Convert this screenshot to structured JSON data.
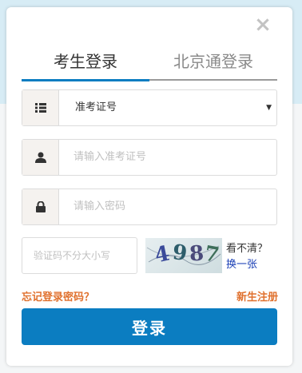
{
  "dialog": {
    "close_glyph": "×",
    "tabs": [
      {
        "label": "考生登录"
      },
      {
        "label": "北京通登录"
      }
    ],
    "id_type": {
      "selected": "准考证号",
      "caret": "▼"
    },
    "id_input": {
      "placeholder": "请输入准考证号"
    },
    "password_input": {
      "placeholder": "请输入密码"
    },
    "captcha": {
      "placeholder": "验证码不分大小写",
      "code": [
        "4",
        "9",
        "8",
        "7"
      ],
      "unclear_label": "看不清？",
      "refresh_label": "换一张"
    },
    "forgot_label": "忘记登录密码？",
    "register_label": "新生注册",
    "login_label": "登录",
    "colors": {
      "accent": "#0b7dc1",
      "link_orange": "#e0712e",
      "link_blue": "#1a3fb5"
    }
  }
}
